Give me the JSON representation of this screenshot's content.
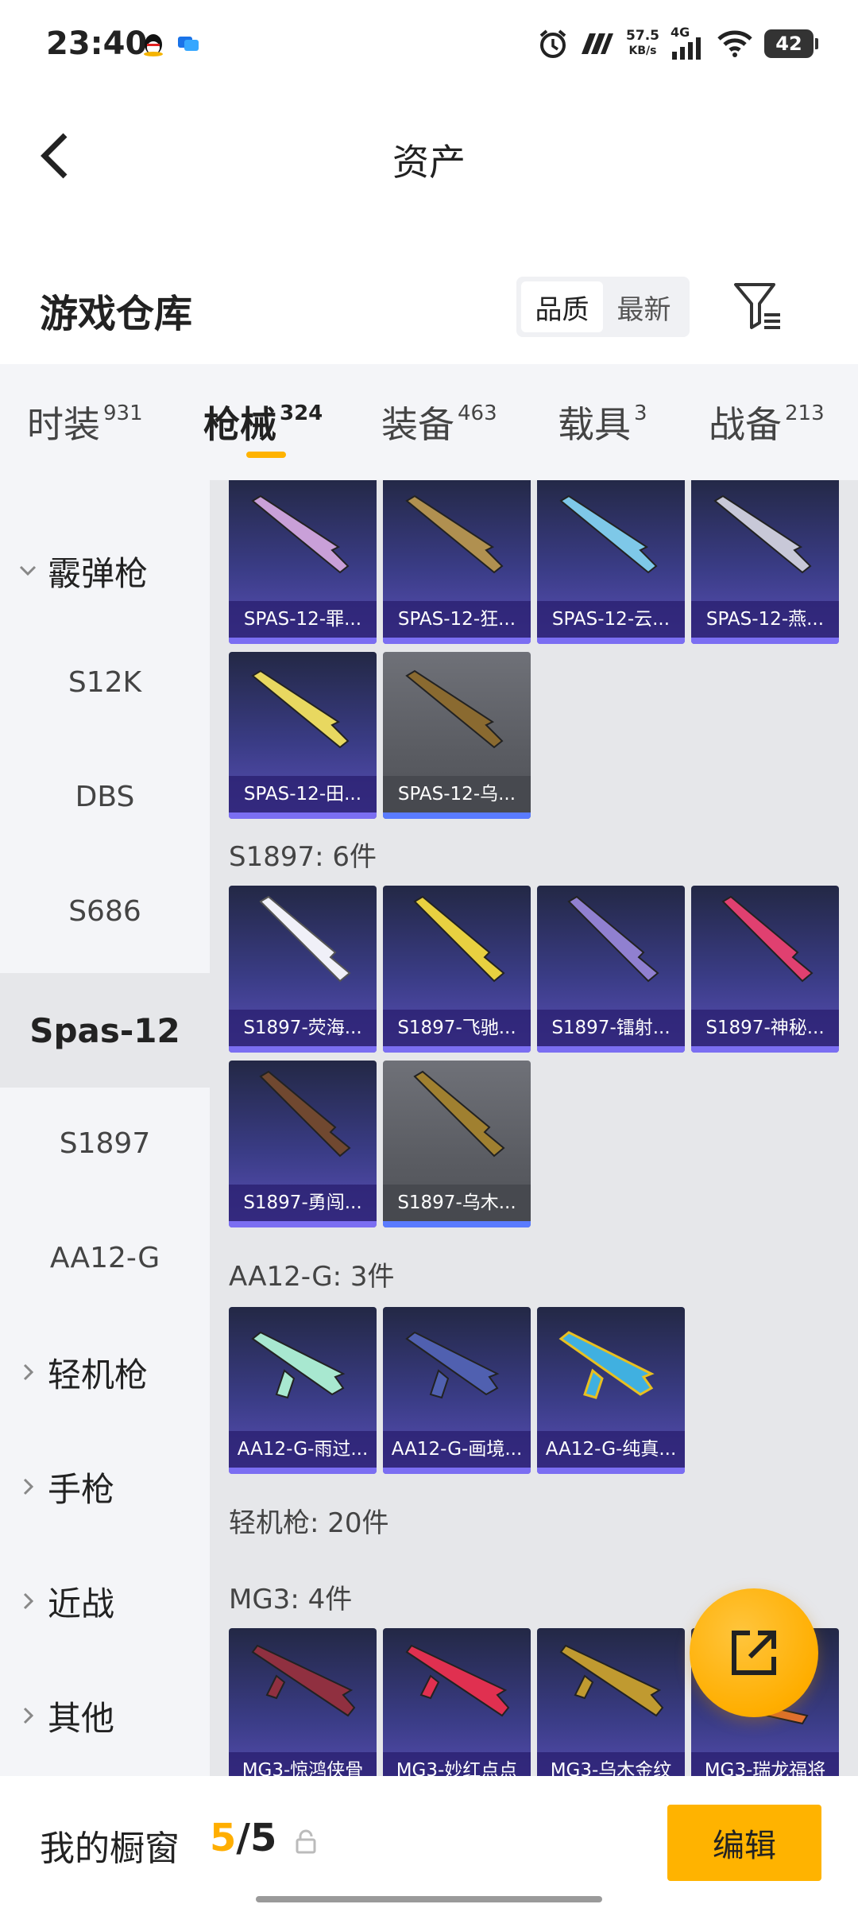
{
  "status": {
    "time": "23:40",
    "speed_top": "57.5",
    "speed_unit": "KB/s",
    "network": "4G",
    "battery": "42"
  },
  "header": {
    "title": "资产"
  },
  "section": {
    "title": "游戏仓库",
    "sort_options": [
      "品质",
      "最新"
    ]
  },
  "tabs": [
    {
      "label": "时装",
      "count": "931"
    },
    {
      "label": "枪械",
      "count": "324"
    },
    {
      "label": "装备",
      "count": "463"
    },
    {
      "label": "载具",
      "count": "3"
    },
    {
      "label": "战备",
      "count": "213"
    }
  ],
  "sidebar": [
    "霰弹枪",
    "S12K",
    "DBS",
    "S686",
    "Spas-12",
    "S1897",
    "AA12-G",
    "轻机枪",
    "手枪",
    "近战",
    "其他"
  ],
  "main": {
    "row1": [
      "SPAS-12-罪...",
      "SPAS-12-狂...",
      "SPAS-12-云...",
      "SPAS-12-燕..."
    ],
    "row2": [
      "SPAS-12-田...",
      "SPAS-12-乌..."
    ],
    "s1897_head": "S1897: 6件",
    "s1897": [
      "S1897-荧海...",
      "S1897-飞驰...",
      "S1897-镭射...",
      "S1897-神秘...",
      "S1897-勇闯...",
      "S1897-乌木..."
    ],
    "aa12_head": "AA12-G: 3件",
    "aa12": [
      "AA12-G-雨过...",
      "AA12-G-画境...",
      "AA12-G-纯真..."
    ],
    "lmg_head": "轻机枪: 20件",
    "mg3_head": "MG3: 4件",
    "mg3": [
      "MG3-惊鸿侠骨",
      "MG3-妙红点点",
      "MG3-乌木金纹",
      "MG3-瑞龙福将"
    ]
  },
  "bottom": {
    "showcase_label": "我的橱窗",
    "count_current": "5",
    "count_sep": "/",
    "count_total": "5",
    "edit_label": "编辑"
  },
  "colors": {
    "accent": "#ffb300",
    "card_purple": "#5b50b8",
    "sidebar_bg": "#f4f5f8"
  }
}
